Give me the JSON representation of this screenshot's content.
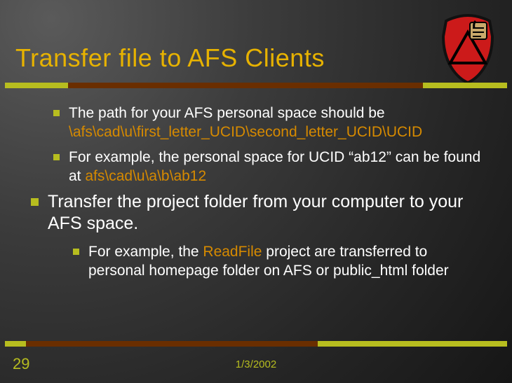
{
  "title": "Transfer file to AFS Clients",
  "page_number": "29",
  "date": "1/3/2002",
  "bullets": {
    "sub1_a": "The path for your AFS personal space should be ",
    "sub1_path": "\\afs\\cad\\u\\first_letter_UCID\\second_letter_UCID\\UCID",
    "sub2_a": "For example, the personal space for UCID  “ab12” can be found at ",
    "sub2_path": "afs\\cad\\u\\a\\b\\ab12",
    "main2": "Transfer the project folder from your computer to your AFS space.",
    "sub3_a": "For example, the ",
    "sub3_hl": "ReadFile",
    "sub3_b": " project are transferred to personal homepage folder on AFS or public_html folder"
  }
}
